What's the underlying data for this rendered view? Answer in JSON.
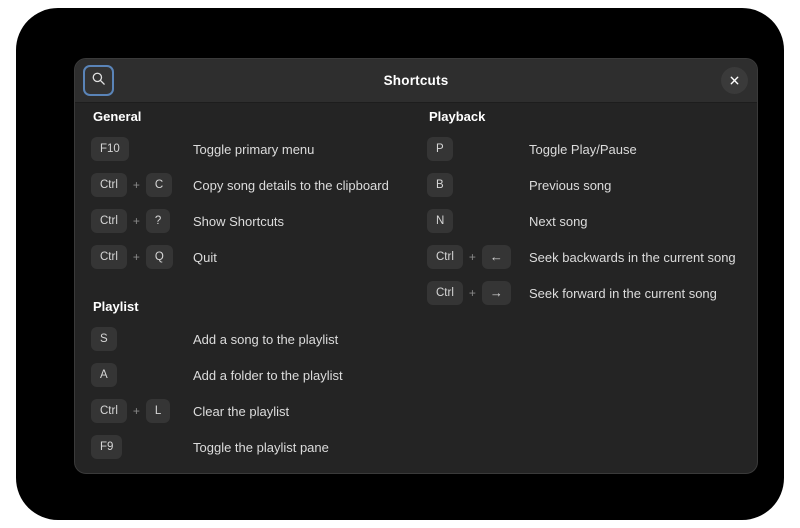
{
  "window": {
    "title": "Shortcuts",
    "search_icon": "search-icon",
    "close_icon": "close-icon"
  },
  "columns": [
    {
      "sections": [
        {
          "heading": "General",
          "rows": [
            {
              "keys": [
                "F10"
              ],
              "description": "Toggle primary menu"
            },
            {
              "keys": [
                "Ctrl",
                "C"
              ],
              "description": "Copy song details to the clipboard"
            },
            {
              "keys": [
                "Ctrl",
                "?"
              ],
              "description": "Show Shortcuts"
            },
            {
              "keys": [
                "Ctrl",
                "Q"
              ],
              "description": "Quit"
            }
          ]
        },
        {
          "heading": "Playlist",
          "rows": [
            {
              "keys": [
                "S"
              ],
              "description": "Add a song to the playlist"
            },
            {
              "keys": [
                "A"
              ],
              "description": "Add a folder to the playlist"
            },
            {
              "keys": [
                "Ctrl",
                "L"
              ],
              "description": "Clear the playlist"
            },
            {
              "keys": [
                "F9"
              ],
              "description": "Toggle the playlist pane"
            }
          ]
        }
      ]
    },
    {
      "sections": [
        {
          "heading": "Playback",
          "rows": [
            {
              "keys": [
                "P"
              ],
              "description": "Toggle Play/Pause"
            },
            {
              "keys": [
                "B"
              ],
              "description": "Previous song"
            },
            {
              "keys": [
                "N"
              ],
              "description": "Next song"
            },
            {
              "keys": [
                "Ctrl",
                "←"
              ],
              "description": "Seek backwards in the current song"
            },
            {
              "keys": [
                "Ctrl",
                "→"
              ],
              "description": "Seek forward in the current song"
            }
          ]
        }
      ]
    }
  ],
  "separator": "+",
  "colors": {
    "window_bg": "#242424",
    "header_bg": "#2e2e2e",
    "key_bg": "#353535",
    "focus_ring": "#5a84b8",
    "backdrop": "#000000"
  }
}
